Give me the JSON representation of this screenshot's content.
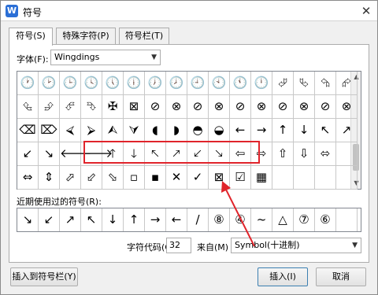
{
  "window": {
    "title": "符号",
    "app_icon": "W",
    "close_glyph": "✕"
  },
  "tabs": [
    {
      "label": "符号(S)",
      "active": true
    },
    {
      "label": "特殊字符(P)",
      "active": false
    },
    {
      "label": "符号栏(T)",
      "active": false
    }
  ],
  "font": {
    "label": "字体(F):",
    "value": "Wingdings"
  },
  "grid": {
    "rows": [
      [
        "🕐",
        "🕑",
        "🕒",
        "🕓",
        "🕔",
        "🕕",
        "🕖",
        "🕗",
        "🕘",
        "🕙",
        "🕚",
        "🕛",
        "⮰",
        "⮱",
        "⮲",
        "⮳"
      ],
      [
        "⮴",
        "⮵",
        "⮶",
        "⮷",
        "✠",
        "⊠",
        "⊘",
        "⊗",
        "⊘",
        "⊗",
        "⊘",
        "⊗",
        "⊘",
        "⊗",
        "⊘",
        "⊗"
      ],
      [
        "⌫",
        "⌦",
        "⮘",
        "⮚",
        "⮙",
        "⮛",
        "◖",
        "◗",
        "◓",
        "◒",
        "←",
        "→",
        "↑",
        "↓",
        "↖",
        "↗"
      ],
      [
        "↙",
        "↘",
        "🡐",
        "🡒",
        "🡑",
        "🡓",
        "🡔",
        "🡕",
        "🡗",
        "🡖",
        "⇦",
        "⇨",
        "⇧",
        "⇩",
        "⬄",
        ""
      ],
      [
        "⇔",
        "⇕",
        "⬀",
        "⬃",
        "⬂",
        "▫",
        "▪",
        "✕",
        "✓",
        "⊠",
        "☑",
        "▦",
        "",
        "",
        "",
        ""
      ]
    ]
  },
  "recent": {
    "label": "近期使用过的符号(R):",
    "symbols": [
      "↘",
      "↙",
      "↗",
      "↖",
      "↓",
      "↑",
      "→",
      "←",
      "/",
      "⑧",
      "④",
      "~",
      "△",
      "⑦",
      "⑥",
      ""
    ]
  },
  "char_code": {
    "label": "字符代码(C):",
    "value": "32"
  },
  "from": {
    "label": "来自(M)",
    "value": "Symbol(十进制)"
  },
  "buttons": {
    "insert_to_bar": "插入到符号栏(Y)",
    "insert": "插入(I)",
    "cancel": "取消"
  },
  "colors": {
    "highlight": "#e0242b",
    "accent": "#2b6fd6"
  }
}
